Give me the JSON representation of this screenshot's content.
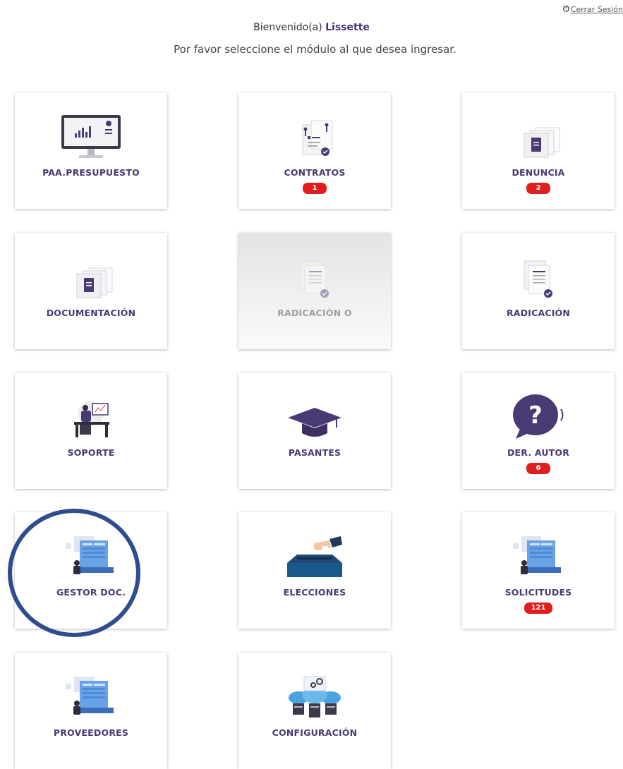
{
  "header": {
    "logout_label": "Cerrar Sesión",
    "welcome_prefix": "Bienvenido(a) ",
    "user_name": "Lissette",
    "subtitle": "Por favor seleccione el módulo al que desea ingresar."
  },
  "colors": {
    "accent": "#4a3a73",
    "badge": "#e01e1e",
    "annotation_circle": "#2e4d8f"
  },
  "modules": [
    {
      "label": "PAA.PRESUPUESTO",
      "icon": "monitor-chart-icon",
      "badge": null,
      "enabled": true
    },
    {
      "label": "CONTRATOS",
      "icon": "contract-documents-icon",
      "badge": "1",
      "enabled": true
    },
    {
      "label": "DENUNCIA",
      "icon": "stacked-documents-icon",
      "badge": "2",
      "enabled": true
    },
    {
      "label": "DOCUMENTACIÓN",
      "icon": "stacked-documents-icon",
      "badge": null,
      "enabled": true
    },
    {
      "label": "RADICACIÓN O",
      "icon": "filed-document-icon",
      "badge": null,
      "enabled": false
    },
    {
      "label": "RADICACIÓN",
      "icon": "filed-document-icon",
      "badge": null,
      "enabled": true
    },
    {
      "label": "SOPORTE",
      "icon": "support-desk-icon",
      "badge": null,
      "enabled": true
    },
    {
      "label": "PASANTES",
      "icon": "graduation-cap-icon",
      "badge": null,
      "enabled": true
    },
    {
      "label": "DER. AUTOR",
      "icon": "question-bubble-icon",
      "badge": "6",
      "enabled": true
    },
    {
      "label": "GESTOR DOC.",
      "icon": "document-manager-icon",
      "badge": null,
      "enabled": true
    },
    {
      "label": "ELECCIONES",
      "icon": "ballot-box-icon",
      "badge": null,
      "enabled": true
    },
    {
      "label": "SOLICITUDES",
      "icon": "document-manager-icon",
      "badge": "121",
      "enabled": true
    },
    {
      "label": "PROVEEDORES",
      "icon": "document-manager-icon",
      "badge": null,
      "enabled": true
    },
    {
      "label": "CONFIGURACIÓN",
      "icon": "cloud-servers-gear-icon",
      "badge": null,
      "enabled": true
    }
  ]
}
